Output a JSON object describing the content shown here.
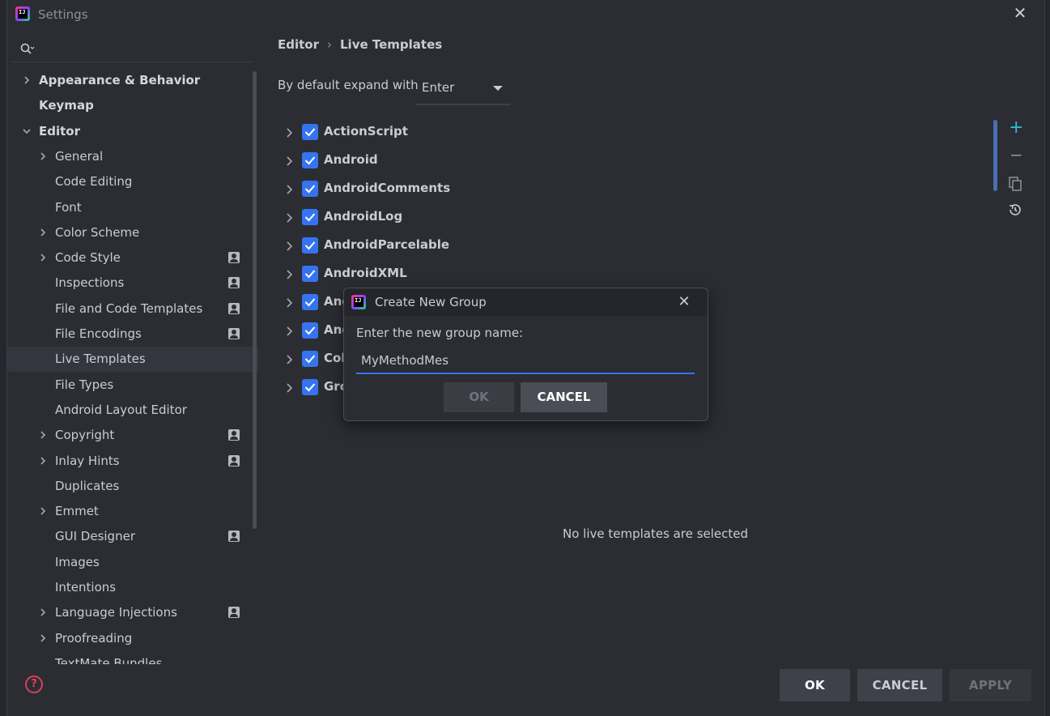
{
  "window": {
    "title": "Settings"
  },
  "sidebar": {
    "items": [
      {
        "label": "Appearance & Behavior",
        "level": 0,
        "arrow": "right",
        "bold": true
      },
      {
        "label": "Keymap",
        "level": 0,
        "arrow": "none",
        "bold": true
      },
      {
        "label": "Editor",
        "level": 0,
        "arrow": "down",
        "bold": true
      },
      {
        "label": "General",
        "level": 1,
        "arrow": "right"
      },
      {
        "label": "Code Editing",
        "level": 1,
        "arrow": "none"
      },
      {
        "label": "Font",
        "level": 1,
        "arrow": "none"
      },
      {
        "label": "Color Scheme",
        "level": 1,
        "arrow": "right"
      },
      {
        "label": "Code Style",
        "level": 1,
        "arrow": "right",
        "user_icon": true
      },
      {
        "label": "Inspections",
        "level": 1,
        "arrow": "none",
        "user_icon": true
      },
      {
        "label": "File and Code Templates",
        "level": 1,
        "arrow": "none",
        "user_icon": true
      },
      {
        "label": "File Encodings",
        "level": 1,
        "arrow": "none",
        "user_icon": true
      },
      {
        "label": "Live Templates",
        "level": 1,
        "arrow": "none",
        "selected": true
      },
      {
        "label": "File Types",
        "level": 1,
        "arrow": "none"
      },
      {
        "label": "Android Layout Editor",
        "level": 1,
        "arrow": "none"
      },
      {
        "label": "Copyright",
        "level": 1,
        "arrow": "right",
        "user_icon": true
      },
      {
        "label": "Inlay Hints",
        "level": 1,
        "arrow": "right",
        "user_icon": true
      },
      {
        "label": "Duplicates",
        "level": 1,
        "arrow": "none"
      },
      {
        "label": "Emmet",
        "level": 1,
        "arrow": "right"
      },
      {
        "label": "GUI Designer",
        "level": 1,
        "arrow": "none",
        "user_icon": true
      },
      {
        "label": "Images",
        "level": 1,
        "arrow": "none"
      },
      {
        "label": "Intentions",
        "level": 1,
        "arrow": "none"
      },
      {
        "label": "Language Injections",
        "level": 1,
        "arrow": "right",
        "user_icon": true
      },
      {
        "label": "Proofreading",
        "level": 1,
        "arrow": "right"
      },
      {
        "label": "TextMate Bundles",
        "level": 1,
        "arrow": "none"
      }
    ]
  },
  "breadcrumb": {
    "parent": "Editor",
    "separator": "›",
    "current": "Live Templates"
  },
  "expand": {
    "label": "By default expand with",
    "value": "Enter"
  },
  "groups": [
    {
      "label": "ActionScript",
      "checked": true
    },
    {
      "label": "Android",
      "checked": true
    },
    {
      "label": "AndroidComments",
      "checked": true
    },
    {
      "label": "AndroidLog",
      "checked": true
    },
    {
      "label": "AndroidParcelable",
      "checked": true
    },
    {
      "label": "AndroidXML",
      "checked": true
    },
    {
      "label": "Ang",
      "checked": true
    },
    {
      "label": "Ang",
      "checked": true
    },
    {
      "label": "Col",
      "checked": true
    },
    {
      "label": "Gro",
      "checked": true
    }
  ],
  "toolbar": {
    "add": "+",
    "remove": "−",
    "copy_icon": "copy-icon",
    "restore_icon": "restore-icon"
  },
  "empty_message": "No live templates are selected",
  "buttons": {
    "ok": "OK",
    "cancel": "CANCEL",
    "apply": "APPLY"
  },
  "dialog": {
    "title": "Create New Group",
    "prompt": "Enter the new group name:",
    "input_value": "MyMethodMes",
    "ok": "OK",
    "cancel": "CANCEL"
  },
  "colors": {
    "accent": "#3574f0",
    "background": "#2b2d33",
    "help": "#d94158",
    "add": "#2fb8d6"
  }
}
